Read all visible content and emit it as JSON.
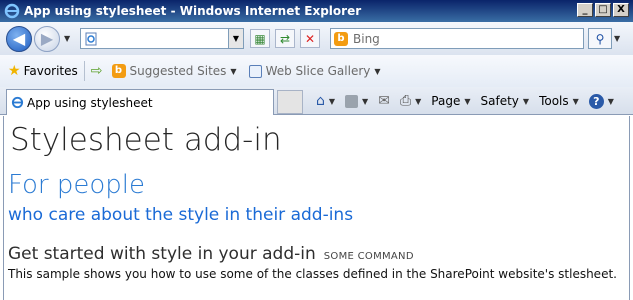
{
  "window": {
    "title": "App using stylesheet - Windows Internet Explorer",
    "minimize": "_",
    "maximize": "□",
    "close": "X"
  },
  "nav": {
    "address_value": "",
    "search_placeholder": "Bing"
  },
  "favorites_bar": {
    "favorites_label": "Favorites",
    "suggested_sites": "Suggested Sites",
    "web_slice_gallery": "Web Slice Gallery"
  },
  "tabs": {
    "active_tab": "App using stylesheet"
  },
  "command_bar": {
    "page": "Page",
    "safety": "Safety",
    "tools": "Tools"
  },
  "content": {
    "title": "Stylesheet add-in",
    "subtitle": "For people",
    "tagline": "who care about the style in their add-ins",
    "section_heading": "Get started with style in your add-in",
    "section_command": "SOME COMMAND",
    "body": "This sample shows you how to use some of the classes defined in the SharePoint website's stlesheet."
  },
  "colors": {
    "titlebar": "#0a246a",
    "subtitle": "#2b7bd3",
    "tagline": "#1a6ad6"
  }
}
